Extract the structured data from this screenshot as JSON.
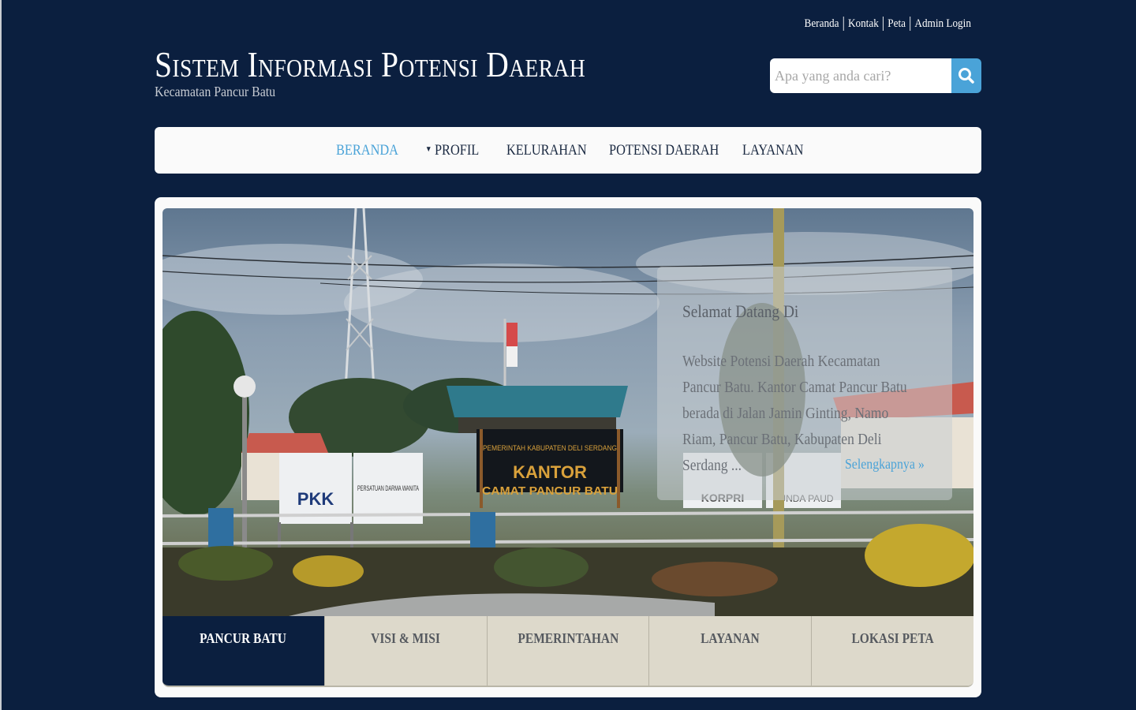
{
  "top_links": [
    "Beranda",
    "Kontak",
    "Peta",
    "Admin Login"
  ],
  "site": {
    "title": "Sistem Informasi Potensi Daerah",
    "subtitle": "Kecamatan Pancur Batu"
  },
  "search": {
    "placeholder": "Apa yang anda cari?",
    "icon": "search-icon"
  },
  "nav": {
    "items": [
      "BERANDA",
      "PROFIL",
      "KELURAHAN",
      "POTENSI DAERAH",
      "LAYANAN"
    ],
    "active": "BERANDA"
  },
  "hero": {
    "signs": {
      "pkk": "PKK",
      "darma": "PERSATUAN DARMA WANITA",
      "kantor_top": "PEMERINTAH KABUPATEN DELI SERDANG",
      "kantor": "KANTOR",
      "camat": "CAMAT PANCUR BATU",
      "korpri": "KORPRI",
      "paud": "BUNDA PAUD"
    },
    "welcome_title": "Selamat Datang Di",
    "welcome_text": "Website Potensi Daerah Kecamatan Pancur Batu. Kantor Camat Pancur Batu berada di Jalan Jamin Ginting, Namo Riam, Pancur Batu, Kabupaten Deli Serdang ...",
    "more_link": "Selengkapnya »"
  },
  "tabs": [
    "PANCUR BATU",
    "VISI & MISI",
    "PEMERINTAHAN",
    "LAYANAN",
    "LOKASI PETA"
  ],
  "colors": {
    "background": "#0b1f3f",
    "accent": "#4aa3d8",
    "tab_bg": "#ddd9cb",
    "tab_active": "#0b1f3f"
  }
}
